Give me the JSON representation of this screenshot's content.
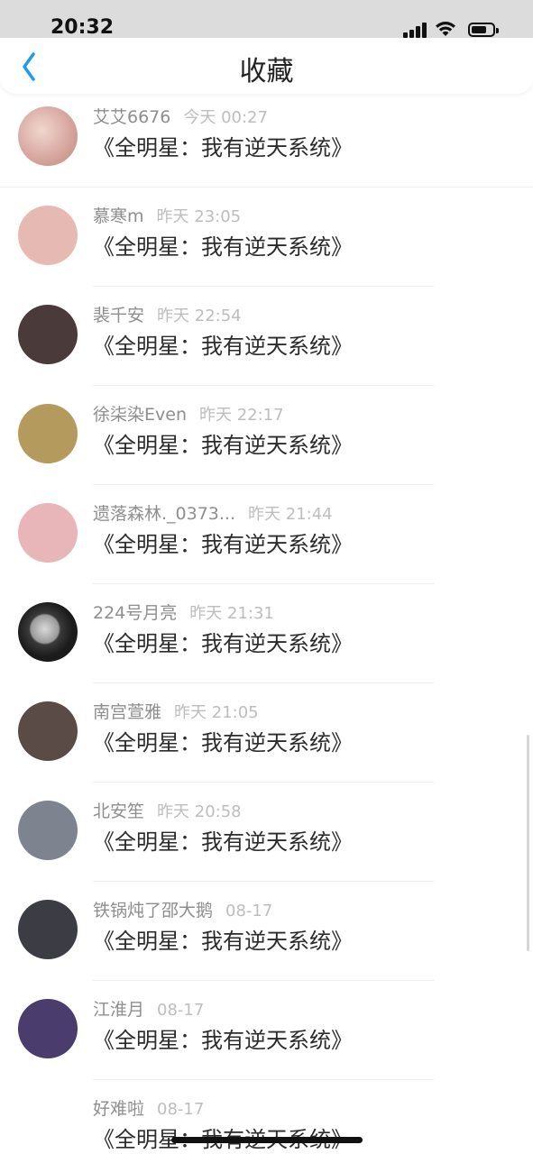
{
  "status_bar": {
    "time": "20:32"
  },
  "nav": {
    "title": "收藏"
  },
  "items": [
    {
      "user": "艾艾6676",
      "time": "今天 00:27",
      "book": "《全明星：我有逆天系统》",
      "avatar_color": "#d8a7a0"
    },
    {
      "user": "慕寒m",
      "time": "昨天 23:05",
      "book": "《全明星：我有逆天系统》",
      "avatar_color": "#e7b9b3"
    },
    {
      "user": "裴千安",
      "time": "昨天 22:54",
      "book": "《全明星：我有逆天系统》",
      "avatar_color": "#4a3a3a"
    },
    {
      "user": "徐柒染Even",
      "time": "昨天 22:17",
      "book": "《全明星：我有逆天系统》",
      "avatar_color": "#b59a5e"
    },
    {
      "user": "遗落森林._0373...",
      "time": "昨天 21:44",
      "book": "《全明星：我有逆天系统》",
      "avatar_color": "#e8b6b9"
    },
    {
      "user": "224号月亮",
      "time": "昨天 21:31",
      "book": "《全明星：我有逆天系统》",
      "avatar_color": "#2a2a2a"
    },
    {
      "user": "南宫萱雅",
      "time": "昨天 21:05",
      "book": "《全明星：我有逆天系统》",
      "avatar_color": "#5b4b46"
    },
    {
      "user": "北安笙",
      "time": "昨天 20:58",
      "book": "《全明星：我有逆天系统》",
      "avatar_color": "#7d838f"
    },
    {
      "user": "铁锅炖了邵大鹅",
      "time": "08-17",
      "book": "《全明星：我有逆天系统》",
      "avatar_color": "#3c3c44"
    },
    {
      "user": "江淮月",
      "time": "08-17",
      "book": "《全明星：我有逆天系统》",
      "avatar_color": "#4a3d6e"
    },
    {
      "user": "好难啦",
      "time": "08-17",
      "book": "《全明星：我有逆天系统》",
      "avatar_color": "#ffffff"
    }
  ]
}
